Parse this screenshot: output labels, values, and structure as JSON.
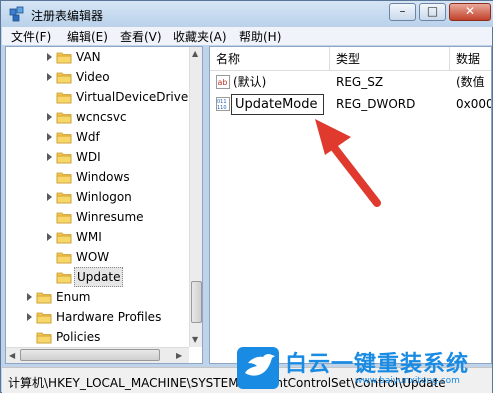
{
  "window": {
    "title": "注册表编辑器"
  },
  "menu": [
    "文件(F)",
    "编辑(E)",
    "查看(V)",
    "收藏夹(A)",
    "帮助(H)"
  ],
  "tree": {
    "items": [
      {
        "label": "VAN",
        "expandable": true,
        "selected": false
      },
      {
        "label": "Video",
        "expandable": true,
        "selected": false
      },
      {
        "label": "VirtualDeviceDriver",
        "expandable": false,
        "selected": false
      },
      {
        "label": "wcncsvc",
        "expandable": true,
        "selected": false
      },
      {
        "label": "Wdf",
        "expandable": true,
        "selected": false
      },
      {
        "label": "WDI",
        "expandable": true,
        "selected": false
      },
      {
        "label": "Windows",
        "expandable": false,
        "selected": false
      },
      {
        "label": "Winlogon",
        "expandable": true,
        "selected": false
      },
      {
        "label": "Winresume",
        "expandable": false,
        "selected": false
      },
      {
        "label": "WMI",
        "expandable": true,
        "selected": false
      },
      {
        "label": "WOW",
        "expandable": false,
        "selected": false
      },
      {
        "label": "Update",
        "expandable": false,
        "selected": true
      },
      {
        "label": "Enum",
        "expandable": true,
        "selected": false
      },
      {
        "label": "Hardware Profiles",
        "expandable": true,
        "selected": false
      },
      {
        "label": "Policies",
        "expandable": false,
        "selected": false
      }
    ]
  },
  "list": {
    "headers": [
      "名称",
      "类型",
      "数据"
    ],
    "rows": [
      {
        "icon": "string-value-icon",
        "name": "(默认)",
        "type": "REG_SZ",
        "data": "(数值"
      },
      {
        "icon": "dword-value-icon",
        "name": "UpdateMode",
        "type": "REG_DWORD",
        "data": "0x000"
      }
    ]
  },
  "status": {
    "path": "计算机\\HKEY_LOCAL_MACHINE\\SYSTEM\\CurrentControlSet\\Control\\Update"
  },
  "watermark": {
    "title": "白云一键重装系统",
    "url": "www.baiyunxitong.com"
  },
  "colors": {
    "accent": "#1a8be3",
    "arrow": "#e03a2f"
  }
}
